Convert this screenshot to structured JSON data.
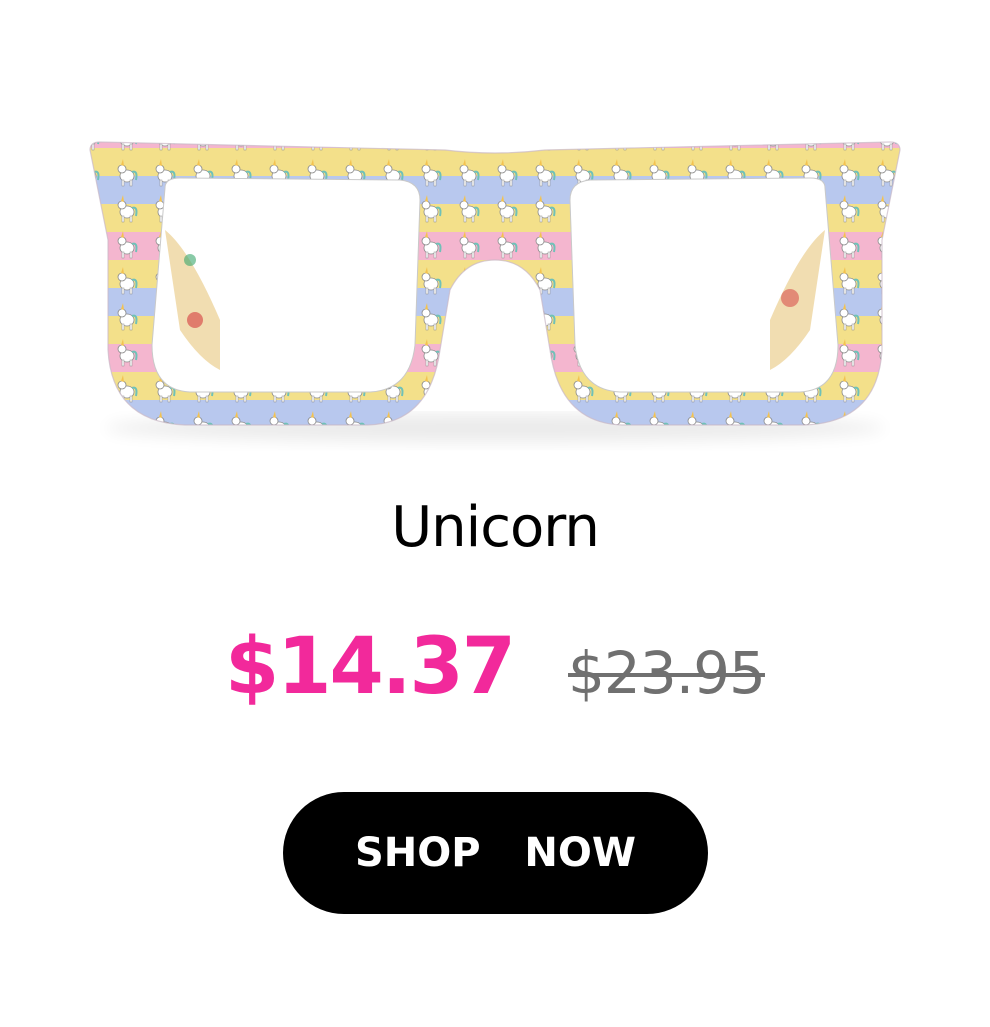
{
  "product": {
    "image_icon": "unicorn-pattern-glasses",
    "name": "Unicorn",
    "sale_price": "$14.37",
    "original_price": "$23.95",
    "cta_label": "SHOP  NOW"
  },
  "colors": {
    "sale_price": "#f2299b",
    "original_price": "#707070",
    "button_bg": "#000000",
    "button_text": "#ffffff",
    "frame_stripes": [
      "#f4b6cf",
      "#f3e08a",
      "#b8c8ee"
    ]
  }
}
